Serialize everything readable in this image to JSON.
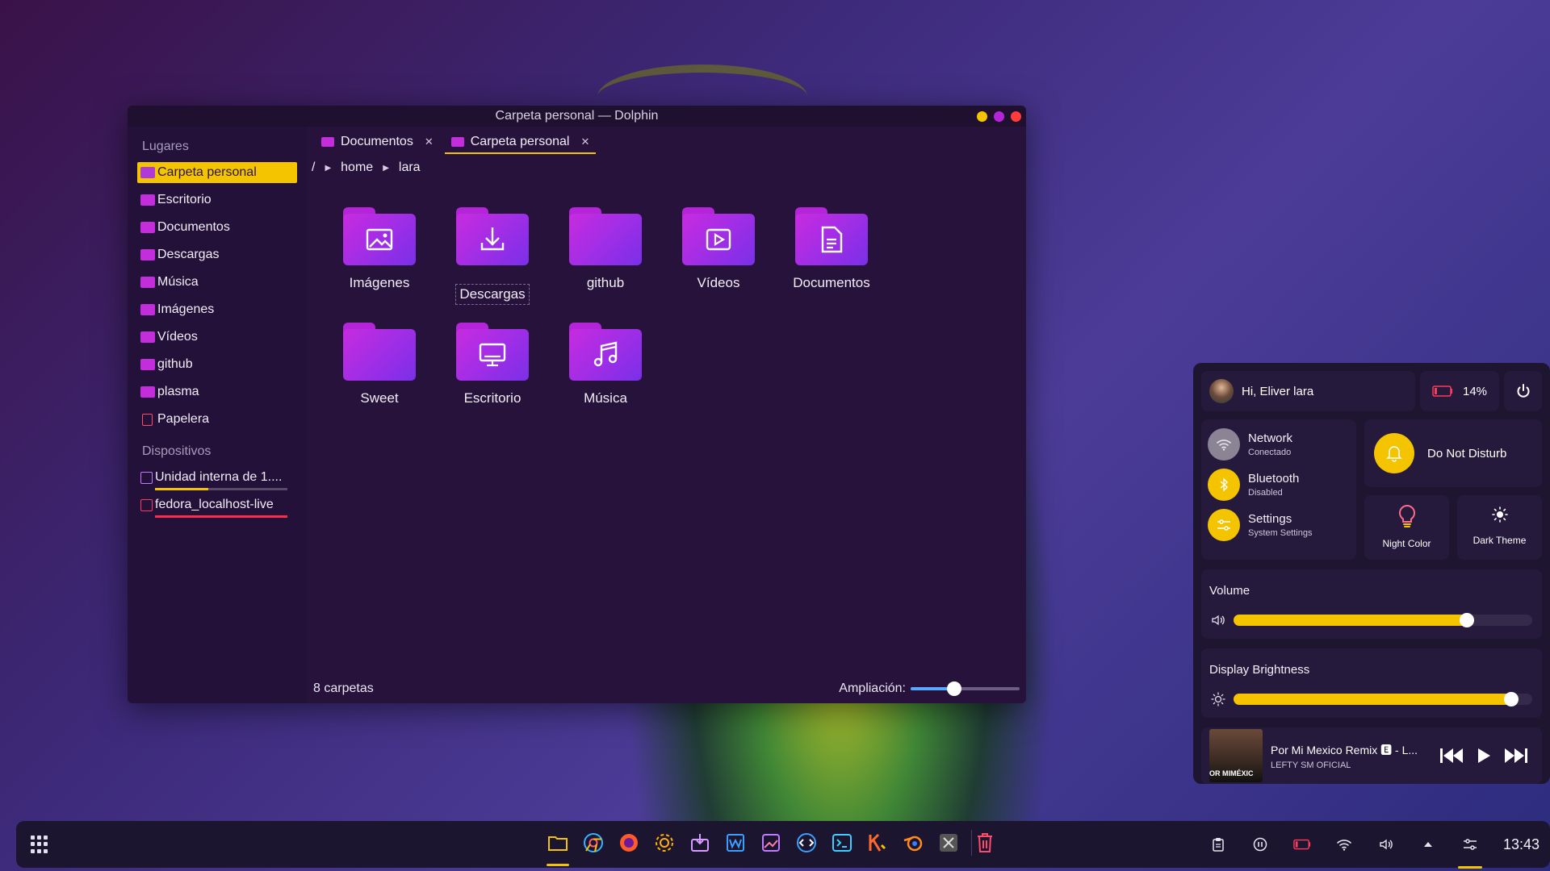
{
  "window": {
    "title": "Carpeta personal — Dolphin",
    "controls": [
      "#f5c400",
      "#b524d8",
      "#ff3b3b"
    ]
  },
  "sidebar": {
    "places_title": "Lugares",
    "places": [
      {
        "label": "Carpeta personal",
        "icon": "home-folder-icon",
        "active": true
      },
      {
        "label": "Escritorio",
        "icon": "desktop-folder-icon"
      },
      {
        "label": "Documentos",
        "icon": "documents-folder-icon"
      },
      {
        "label": "Descargas",
        "icon": "downloads-folder-icon"
      },
      {
        "label": "Música",
        "icon": "music-folder-icon"
      },
      {
        "label": "Imágenes",
        "icon": "pictures-folder-icon"
      },
      {
        "label": "Vídeos",
        "icon": "videos-folder-icon"
      },
      {
        "label": "github",
        "icon": "folder-icon"
      },
      {
        "label": "plasma",
        "icon": "folder-icon"
      },
      {
        "label": "Papelera",
        "icon": "trash-icon"
      }
    ],
    "devices_title": "Dispositivos",
    "devices": [
      {
        "label": "Unidad interna de 1....",
        "icon": "internal-drive-icon",
        "usage_fraction": 0.4,
        "bar_color": "#f5c400"
      },
      {
        "label": "fedora_localhost-live",
        "icon": "removable-drive-icon",
        "usage_fraction": 1.0,
        "bar_color": "#ff2b4a"
      }
    ]
  },
  "tabs": [
    {
      "label": "Documentos",
      "active": false
    },
    {
      "label": "Carpeta personal",
      "active": true
    }
  ],
  "breadcrumb": {
    "root": "/",
    "parts": [
      "home",
      "lara"
    ]
  },
  "folders": [
    {
      "label": "Imágenes",
      "icon": "image-icon"
    },
    {
      "label": "Descargas",
      "icon": "download-icon",
      "focused": true
    },
    {
      "label": "github",
      "icon": ""
    },
    {
      "label": "Vídeos",
      "icon": "play-icon"
    },
    {
      "label": "Documentos",
      "icon": "document-icon"
    },
    {
      "label": "Sweet",
      "icon": ""
    },
    {
      "label": "Escritorio",
      "icon": "monitor-icon"
    },
    {
      "label": "Música",
      "icon": "music-note-icon"
    }
  ],
  "statusbar": {
    "count": "8 carpetas",
    "zoom_label": "Ampliación:",
    "zoom_fraction": 0.4
  },
  "panel": {
    "greeting": "Hi, Eliver lara",
    "battery": "14%",
    "network": {
      "title": "Network",
      "sub": "Conectado"
    },
    "bluetooth": {
      "title": "Bluetooth",
      "sub": "Disabled"
    },
    "settings": {
      "title": "Settings",
      "sub": "System Settings"
    },
    "dnd": "Do Not Disturb",
    "night_color": "Night Color",
    "dark_theme": "Dark Theme",
    "volume": {
      "label": "Volume",
      "level": 0.78
    },
    "brightness": {
      "label": "Display Brightness",
      "level": 0.93
    },
    "media": {
      "title": "Por Mi Mexico Remix 🅴 - L...",
      "artist": "LEFTY SM OFICIAL",
      "cover_text": "OR MIMÉXIC"
    },
    "accent": "#f5c400"
  },
  "taskbar": {
    "apps": [
      {
        "name": "dolphin-icon",
        "color": "#f5c400",
        "running": true
      },
      {
        "name": "chrome-icon",
        "color": "#36b3ff"
      },
      {
        "name": "firefox-icon",
        "color": "#ff5a2a"
      },
      {
        "name": "system-settings-icon",
        "color": "#ffb000"
      },
      {
        "name": "discover-icon",
        "color": "#d69cff"
      },
      {
        "name": "writer-icon",
        "color": "#3aa0ff"
      },
      {
        "name": "image-viewer-icon",
        "color": "#c07bff"
      },
      {
        "name": "vscode-icon",
        "color": "#3aa0ff"
      },
      {
        "name": "terminal-icon",
        "color": "#3ad0ff"
      },
      {
        "name": "kdenlive-icon",
        "color": "#ff6a2a"
      },
      {
        "name": "blender-icon",
        "color": "#ff8c1a"
      },
      {
        "name": "x-app-icon",
        "color": "#aaaaaa"
      },
      {
        "name": "trash-icon",
        "color": "#ff4a6a"
      }
    ],
    "clock": "13:43"
  }
}
